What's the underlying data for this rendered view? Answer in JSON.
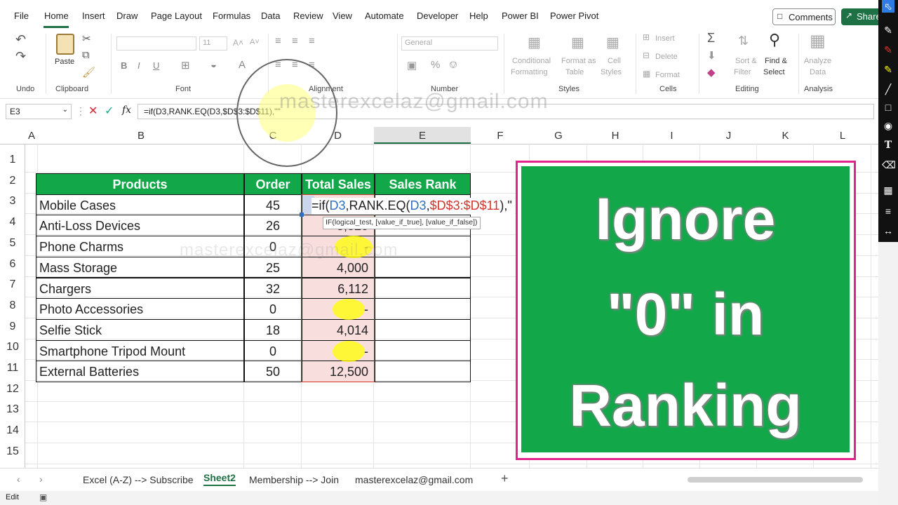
{
  "menu": {
    "items": [
      "File",
      "Home",
      "Insert",
      "Draw",
      "Page Layout",
      "Formulas",
      "Data",
      "Review",
      "View",
      "Automate",
      "Developer",
      "Help",
      "Power BI",
      "Power Pivot"
    ],
    "comments_label": "Comments",
    "share_label": "Share"
  },
  "ribbon": {
    "groups": {
      "undo": "Undo",
      "clipboard": "Clipboard",
      "font": "Font",
      "alignment": "Alignment",
      "number": "Number",
      "styles": "Styles",
      "cells": "Cells",
      "editing": "Editing",
      "analysis": "Analysis"
    },
    "paste_label": "Paste",
    "font_size": "11",
    "number_format": "General",
    "conditional_formatting": [
      "Conditional",
      "Formatting"
    ],
    "format_as_table": [
      "Format as",
      "Table"
    ],
    "cell_styles": [
      "Cell",
      "Styles"
    ],
    "insert_label": "Insert",
    "delete_label": "Delete",
    "format_label": "Format",
    "sort_filter": [
      "Sort &",
      "Filter"
    ],
    "find_select": [
      "Find &",
      "Select"
    ],
    "analyze_data": [
      "Analyze",
      "Data"
    ]
  },
  "formula_bar": {
    "name_box": "E3",
    "formula": "=if(D3,RANK.EQ(D3,$D$3:$D$11),\"\"",
    "fx": "fx"
  },
  "columns": [
    "A",
    "B",
    "C",
    "D",
    "E",
    "F",
    "G",
    "H",
    "I",
    "J",
    "K",
    "L"
  ],
  "rows": [
    "1",
    "2",
    "3",
    "4",
    "5",
    "6",
    "7",
    "8",
    "9",
    "10",
    "11",
    "12",
    "13",
    "14",
    "15"
  ],
  "table": {
    "headers": [
      "Products",
      "Order",
      "Total Sales",
      "Sales Rank"
    ],
    "rows": [
      {
        "product": "Mobile Cases",
        "order": "45",
        "sales": ""
      },
      {
        "product": "Anti-Loss Devices",
        "order": "26",
        "sales": "5,320"
      },
      {
        "product": "Phone Charms",
        "order": "0",
        "sales": "-"
      },
      {
        "product": "Mass Storage",
        "order": "25",
        "sales": "4,000"
      },
      {
        "product": "Chargers",
        "order": "32",
        "sales": "6,112"
      },
      {
        "product": "Photo Accessories",
        "order": "0",
        "sales": "-"
      },
      {
        "product": "Selfie Stick",
        "order": "18",
        "sales": "4,014"
      },
      {
        "product": "Smartphone Tripod Mount",
        "order": "0",
        "sales": "-"
      },
      {
        "product": "External Batteries",
        "order": "50",
        "sales": "12,500"
      }
    ]
  },
  "cell_edit": {
    "parts": [
      "=if(",
      "D3",
      ",RANK.EQ(",
      "D3",
      ",",
      "$D$3:$D$11",
      "),",
      "\""
    ],
    "tooltip": "IF(logical_test, [value_if_true], [value_if_false])"
  },
  "banner": {
    "line1": "Ignore",
    "line2": "\"0\" in",
    "line3": "Ranking"
  },
  "watermark": "masterexcelaz@gmail.com",
  "sheets": [
    "Excel (A-Z) --> Subscribe",
    "Sheet2",
    "Membership --> Join",
    "masterexcelaz@gmail.com"
  ],
  "active_sheet": "Sheet2",
  "status": "Edit",
  "colors": {
    "accent": "#1e7145",
    "table_header": "#12a84a",
    "banner_border": "#e0248c"
  }
}
